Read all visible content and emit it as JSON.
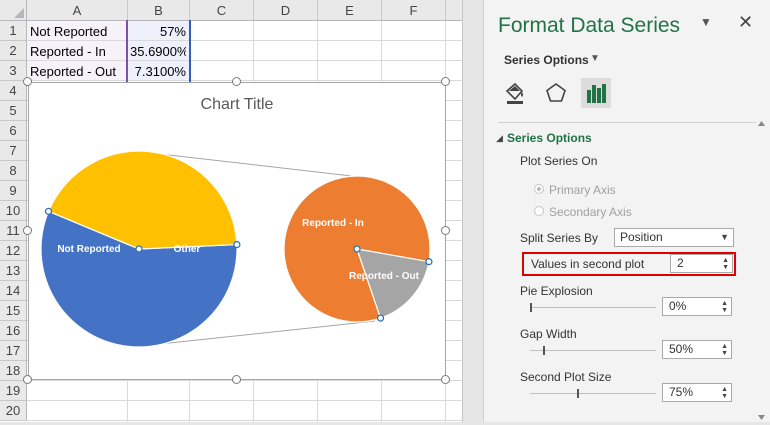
{
  "sheet": {
    "columns": [
      "A",
      "B",
      "C",
      "D",
      "E",
      "F"
    ],
    "rows": [
      "1",
      "2",
      "3",
      "4",
      "5",
      "6",
      "7",
      "8",
      "9",
      "10",
      "11",
      "12",
      "13",
      "14",
      "15",
      "16",
      "17",
      "18",
      "19",
      "20"
    ],
    "cells": [
      {
        "a": "Not Reported",
        "b": "57%"
      },
      {
        "a": "Reported - In",
        "b": "35.6900%"
      },
      {
        "a": "Reported - Out",
        "b": "7.3100%"
      }
    ]
  },
  "chart": {
    "title": "Chart Title",
    "labels": {
      "not_reported": "Not Reported",
      "other": "Other",
      "reported_in": "Reported - In",
      "reported_out": "Reported - Out"
    },
    "colors": {
      "blue": "#4472C4",
      "gold": "#FFC000",
      "orange": "#ED7D31",
      "gray": "#A5A5A5"
    }
  },
  "chart_data": {
    "type": "pie",
    "title": "Chart Title",
    "subtype": "pie-of-pie",
    "categories": [
      "Not Reported",
      "Reported - In",
      "Reported - Out"
    ],
    "values": [
      57,
      35.69,
      7.31
    ],
    "primary_pie": [
      {
        "name": "Not Reported",
        "value": 57
      },
      {
        "name": "Other",
        "value": 43
      }
    ],
    "secondary_pie": [
      {
        "name": "Reported - In",
        "value": 35.69
      },
      {
        "name": "Reported - Out",
        "value": 7.31
      }
    ]
  },
  "pane": {
    "title": "Format Data Series",
    "dropdown_icon": "chevron-down-icon",
    "close_icon": "close-icon",
    "series_options_label": "Series Options",
    "tabs": [
      "fill-line-icon",
      "effects-pentagon-icon",
      "series-options-bar-icon"
    ],
    "section_title": "Series Options",
    "plot_series_on": "Plot Series On",
    "primary_axis": "Primary Axis",
    "secondary_axis": "Secondary Axis",
    "split_series_by_label": "Split Series By",
    "split_series_by_value": "Position",
    "values_in_second_plot_label": "Values in second plot",
    "values_in_second_plot_value": "2",
    "pie_explosion_label": "Pie Explosion",
    "pie_explosion_value": "0%",
    "gap_width_label": "Gap Width",
    "gap_width_value": "50%",
    "second_plot_size_label": "Second Plot Size",
    "second_plot_size_value": "75%",
    "slider_levels": {
      "pie_explosion": 0,
      "gap_width": 0.1,
      "second_plot_size": 0.375
    },
    "accent": "#217346",
    "highlight": "#E00000"
  }
}
